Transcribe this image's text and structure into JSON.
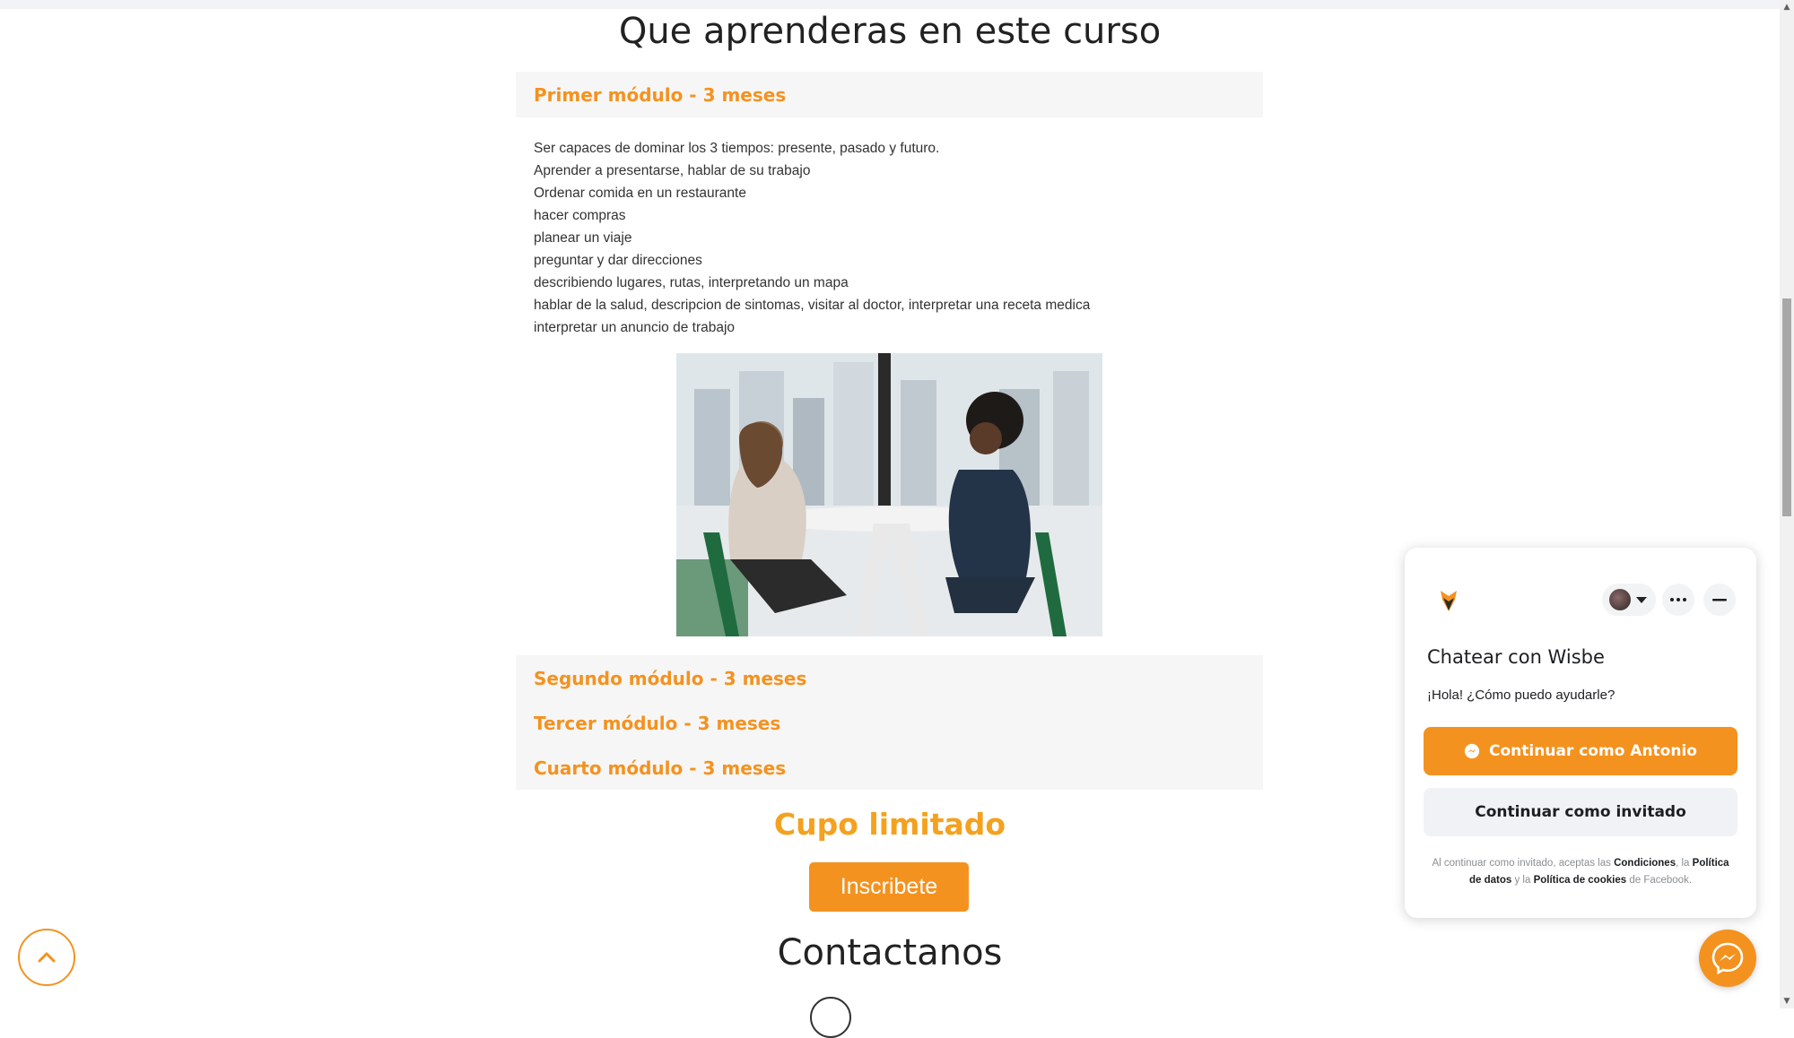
{
  "header": {
    "title": "Que aprenderas en este curso"
  },
  "modules": {
    "first": {
      "label": "Primer módulo - 3 meses",
      "topics": [
        "Ser capaces de dominar los 3 tiempos: presente, pasado y futuro.",
        "Aprender a presentarse, hablar de su trabajo",
        "Ordenar comida en un restaurante",
        "hacer compras",
        "planear un viaje",
        "preguntar y dar direcciones",
        "describiendo lugares, rutas, interpretando un mapa",
        "hablar de la salud, descripcion de sintomas, visitar al doctor, interpretar una receta medica",
        "interpretar un anuncio de trabajo"
      ]
    },
    "second": {
      "label": "Segundo módulo - 3 meses"
    },
    "third": {
      "label": "Tercer módulo - 3 meses"
    },
    "fourth": {
      "label": "Cuarto módulo - 3 meses"
    }
  },
  "cta": {
    "headline": "Cupo limitado",
    "button": "Inscribete"
  },
  "contact": {
    "title": "Contactanos"
  },
  "chat_widget": {
    "title": "Chatear con Wisbe",
    "greeting": "¡Hola! ¿Cómo puedo ayudarle?",
    "primary_button": "Continuar como Antonio",
    "secondary_button": "Continuar como invitado",
    "legal": {
      "prefix": "Al continuar como invitado, aceptas las",
      "conditions": "Condiciones",
      "sep1": ", la",
      "data_policy": "Política de datos",
      "sep2": "y la",
      "cookie_policy": "Política de cookies",
      "suffix": "de Facebook."
    }
  },
  "colors": {
    "accent": "#f4921f",
    "cta_headline": "#f4a11f"
  },
  "icons": {
    "back_to_top": "chevron-up-icon",
    "messenger": "messenger-icon",
    "more": "more-dots-icon",
    "minimize": "minimize-icon"
  }
}
